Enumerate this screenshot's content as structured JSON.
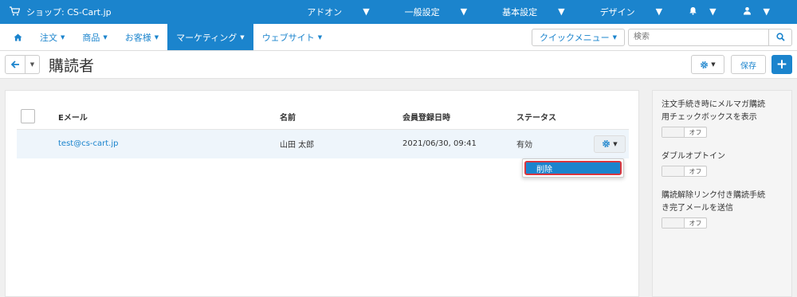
{
  "topbar": {
    "store_label": "ショップ: CS-Cart.jp",
    "menus": [
      "アドオン",
      "一般設定",
      "基本設定",
      "デザイン"
    ]
  },
  "nav": {
    "items": [
      "注文",
      "商品",
      "お客様",
      "マーケティング",
      "ウェブサイト"
    ],
    "active_index": 3,
    "quick_menu": "クイックメニュー",
    "search_placeholder": "検索"
  },
  "page": {
    "title": "購読者",
    "save_label": "保存"
  },
  "table": {
    "headers": [
      "Eメール",
      "名前",
      "会員登録日時",
      "ステータス"
    ],
    "rows": [
      {
        "email": "test@cs-cart.jp",
        "name": "山田 太郎",
        "registered": "2021/06/30, 09:41",
        "status": "有効"
      }
    ]
  },
  "dropdown": {
    "items": [
      "削除"
    ]
  },
  "sidebar": {
    "settings": [
      {
        "label": "注文手続き時にメルマガ購読用チェックボックスを表示",
        "toggle": "オフ"
      },
      {
        "label": "ダブルオプトイン",
        "toggle": "オフ"
      },
      {
        "label": "購読解除リンク付き購読手続き完了メールを送信",
        "toggle": "オフ"
      }
    ]
  },
  "colors": {
    "brand": "#1b84cd",
    "highlight_border": "#d9363e"
  },
  "icons": [
    "cart-icon",
    "bell-icon",
    "user-icon",
    "home-icon",
    "search-icon",
    "arrow-left-icon",
    "gear-icon",
    "plus-icon"
  ]
}
